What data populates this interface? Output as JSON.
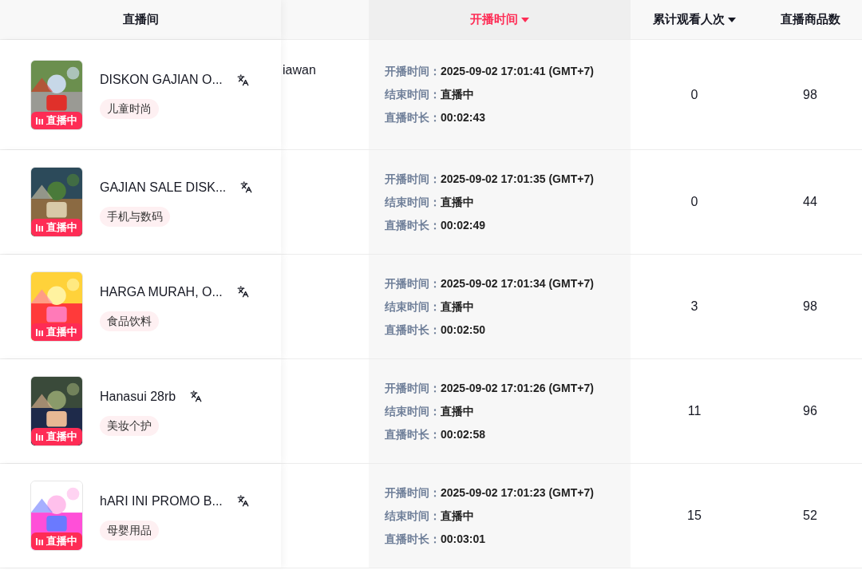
{
  "columns": [
    {
      "label": "直播间",
      "sortable": false,
      "selected": false
    },
    {
      "label": "开播时间",
      "sortable": true,
      "selected": true
    },
    {
      "label": "累计观看人次",
      "sortable": true,
      "selected": false
    },
    {
      "label": "直播商品数",
      "sortable": false,
      "selected": false
    }
  ],
  "rows": [
    {
      "title": "DISKON GAJIAN O...",
      "badge": "直播中",
      "category": "儿童时尚",
      "column_2": "iawan",
      "times": [
        {
          "label": "开播时间：",
          "value": "2025-09-02 17:01:41 (GMT+7)"
        },
        {
          "label": "结束时间：",
          "value": "直播中"
        },
        {
          "label": "直播时长：",
          "value": "00:02:43"
        }
      ],
      "views": "0",
      "products": "98"
    },
    {
      "title": "GAJIAN SALE DISK...",
      "badge": "直播中",
      "category": "手机与数码",
      "times": [
        {
          "label": "开播时间：",
          "value": "2025-09-02 17:01:35 (GMT+7)"
        },
        {
          "label": "结束时间：",
          "value": "直播中"
        },
        {
          "label": "直播时长：",
          "value": "00:02:49"
        }
      ],
      "views": "0",
      "products": "44"
    },
    {
      "title": "HARGA MURAH, O...",
      "badge": "直播中",
      "category": "食品饮料",
      "times": [
        {
          "label": "开播时间：",
          "value": "2025-09-02 17:01:34 (GMT+7)"
        },
        {
          "label": "结束时间：",
          "value": "直播中"
        },
        {
          "label": "直播时长：",
          "value": "00:02:50"
        }
      ],
      "views": "3",
      "products": "98"
    },
    {
      "title": "Hanasui 28rb",
      "badge": "直播中",
      "category": "美妆个护",
      "times": [
        {
          "label": "开播时间：",
          "value": "2025-09-02 17:01:26 (GMT+7)"
        },
        {
          "label": "结束时间：",
          "value": "直播中"
        },
        {
          "label": "直播时长：",
          "value": "00:02:58"
        }
      ],
      "views": "11",
      "products": "96"
    },
    {
      "title": "hARI INI PROMO B...",
      "badge": "直播中",
      "category": "母婴用品",
      "times": [
        {
          "label": "开播时间：",
          "value": "2025-09-02 17:01:23 (GMT+7)"
        },
        {
          "label": "结束时间：",
          "value": "直播中"
        },
        {
          "label": "直播时长：",
          "value": "00:03:01"
        }
      ],
      "views": "15",
      "products": "52"
    }
  ]
}
